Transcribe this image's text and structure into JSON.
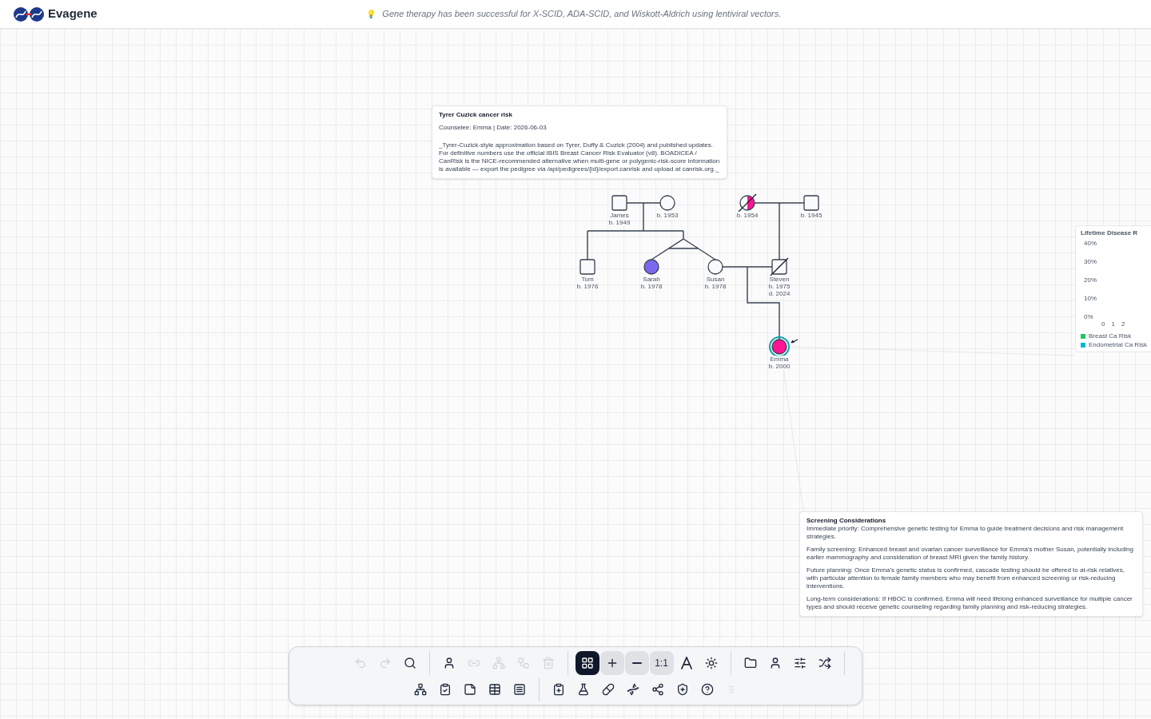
{
  "header": {
    "app_name": "Evagene",
    "tip_icon": "💡",
    "tip": "Gene therapy has been successful for X-SCID, ADA-SCID, and Wiskott-Aldrich using lentiviral vectors."
  },
  "risk_note": {
    "title": "Tyrer Cuzick cancer risk",
    "meta": "Counselee: Emma | Date: 2026-06-03",
    "body": "_Tyrer-Cuzick-style approximation based on Tyrer, Duffy & Cuzick (2004) and published updates. For definitive numbers use the official IBIS Breast Cancer Risk Evaluator (v8). BOADICEA / CanRisk is the NICE-recommended alternative when multi-gene or polygenic-risk-score information is available — export the pedigree via /api/pedigrees/{id}/export.canrisk and upload at canrisk.org._"
  },
  "pedigree": {
    "individuals": [
      {
        "kind": "male",
        "labels": [
          "James",
          "b. 1949"
        ],
        "affected": false,
        "deceased": false,
        "proband": false
      },
      {
        "kind": "female",
        "labels": [
          "b. 1953"
        ],
        "affected": false,
        "deceased": false,
        "proband": false
      },
      {
        "kind": "female",
        "labels": [
          "b. 1954"
        ],
        "affected": true,
        "partial": true,
        "color": "#ff1493",
        "deceased": true,
        "proband": false
      },
      {
        "kind": "male",
        "labels": [
          "b. 1945"
        ],
        "affected": false,
        "deceased": false,
        "proband": false
      },
      {
        "kind": "male",
        "labels": [
          "Tom",
          "b. 1976"
        ],
        "affected": false,
        "deceased": false,
        "proband": false
      },
      {
        "kind": "female",
        "labels": [
          "Sarah",
          "b. 1978"
        ],
        "affected": true,
        "partial": false,
        "color": "#7b68ee",
        "deceased": false,
        "proband": false
      },
      {
        "kind": "female",
        "labels": [
          "Susan",
          "b. 1978"
        ],
        "affected": false,
        "deceased": false,
        "proband": false
      },
      {
        "kind": "male",
        "labels": [
          "Steven",
          "b. 1975",
          "d. 2024"
        ],
        "affected": false,
        "deceased": true,
        "proband": false
      },
      {
        "kind": "female",
        "labels": [
          "Emma",
          "b. 2000"
        ],
        "affected": true,
        "partial": false,
        "color": "#ff1493",
        "deceased": false,
        "proband": true
      }
    ]
  },
  "disease_chart": {
    "title": "Lifetime Disease R",
    "y_labels": [
      "40%",
      "30%",
      "20%",
      "10%",
      "0%"
    ],
    "x_labels": [
      "0",
      "1",
      "2"
    ],
    "legend": [
      {
        "label": "Breast Ca Risk",
        "color": "#22c55e"
      },
      {
        "label": "Endometrial Ca Risk",
        "color": "#06b6d4"
      }
    ]
  },
  "screening_note": {
    "title": "Screening Considerations",
    "paragraphs": [
      "Immediate priority: Comprehensive genetic testing for Emma to guide treatment decisions and risk management strategies.",
      "Family screening: Enhanced breast and ovarian cancer surveillance for Emma's mother Susan, potentially including earlier mammography and consideration of breast MRI given the family history.",
      "Future planning: Once Emma's genetic status is confirmed, cascade testing should be offered to at-risk relatives, with particular attention to female family members who may benefit from enhanced screening or risk-reducing interventions.",
      "Long-term considerations: If HBOC is confirmed, Emma will need lifelong enhanced surveillance for multiple cancer types and should receive genetic counseling regarding family planning and risk-reducing strategies."
    ]
  },
  "toolbar": {
    "rows": [
      [
        {
          "kind": "icon",
          "disabled": true,
          "selected": false
        },
        {
          "kind": "icon",
          "disabled": true,
          "selected": false
        },
        {
          "kind": "icon",
          "disabled": false,
          "selected": false
        },
        {
          "kind": "divider"
        },
        {
          "kind": "icon",
          "disabled": false,
          "selected": false
        },
        {
          "kind": "icon",
          "disabled": true,
          "selected": false
        },
        {
          "kind": "icon",
          "disabled": true,
          "selected": false
        },
        {
          "kind": "icon",
          "disabled": true,
          "selected": false
        },
        {
          "kind": "icon",
          "disabled": true,
          "selected": false
        },
        {
          "kind": "divider"
        },
        {
          "kind": "icon",
          "disabled": false,
          "selected": true
        },
        {
          "kind": "icon",
          "disabled": false,
          "selected": false,
          "shaded": true
        },
        {
          "kind": "icon",
          "disabled": false,
          "selected": false,
          "shaded": true
        },
        {
          "kind": "text",
          "label": "1:1",
          "disabled": false,
          "selected": false,
          "shaded": true
        },
        {
          "kind": "icon",
          "disabled": false,
          "selected": false
        },
        {
          "kind": "icon",
          "disabled": false,
          "selected": false
        },
        {
          "kind": "divider"
        },
        {
          "kind": "icon",
          "disabled": false,
          "selected": false
        },
        {
          "kind": "icon",
          "disabled": false,
          "selected": false
        },
        {
          "kind": "icon",
          "disabled": false,
          "selected": false
        },
        {
          "kind": "icon",
          "disabled": false,
          "selected": false
        },
        {
          "kind": "divider"
        }
      ],
      [
        {
          "kind": "icon",
          "disabled": false,
          "selected": false
        },
        {
          "kind": "icon",
          "disabled": false,
          "selected": false
        },
        {
          "kind": "icon",
          "disabled": false,
          "selected": false
        },
        {
          "kind": "icon",
          "disabled": false,
          "selected": false
        },
        {
          "kind": "icon",
          "disabled": false,
          "selected": false
        },
        {
          "kind": "divider"
        },
        {
          "kind": "icon",
          "disabled": false,
          "selected": false
        },
        {
          "kind": "icon",
          "disabled": false,
          "selected": false
        },
        {
          "kind": "icon",
          "disabled": false,
          "selected": false
        },
        {
          "kind": "icon",
          "disabled": false,
          "selected": false
        },
        {
          "kind": "icon",
          "disabled": false,
          "selected": false
        },
        {
          "kind": "icon",
          "disabled": false,
          "selected": false
        },
        {
          "kind": "icon",
          "disabled": false,
          "selected": false
        },
        {
          "kind": "handle"
        }
      ]
    ]
  }
}
